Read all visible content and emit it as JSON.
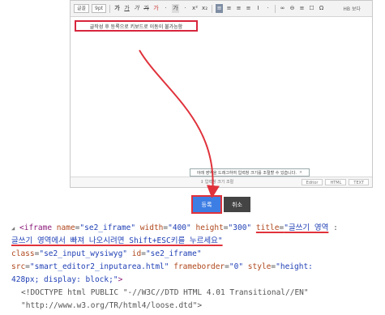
{
  "toolbar": {
    "font_select": "글꼴",
    "size_select": "9pt",
    "buttons": [
      "가",
      "가",
      "가",
      "가",
      "가",
      "·",
      "가",
      "·",
      "x²",
      "x₂",
      "≡",
      "≡",
      "≡",
      "≡",
      "I",
      "·",
      "∞",
      "⊖",
      "≡",
      "☐",
      "Ω"
    ],
    "right_label": "HB 보다"
  },
  "editor": {
    "tip_text": "글작성 후 등록으로 키보드로 이동이 불가능함",
    "status_tip": "아래 영역을 드래그하여 입력창 크기를 조절할 수 있습니다.",
    "status_tip_close": "×",
    "resize_label": "↕ 입력창 크기 조절",
    "modes": [
      "Editor",
      "HTML",
      "TEXT"
    ]
  },
  "buttons": {
    "confirm": "등록",
    "cancel": "취소"
  },
  "code": {
    "line1_triangle": "◢",
    "line1_tag_open": "<iframe",
    "line1_a1": "name",
    "line1_v1": "\"se2_iframe\"",
    "line1_a2": "width",
    "line1_v2": "\"400\"",
    "line1_a3": "height",
    "line1_v3": "\"300\"",
    "line1_a4": "title",
    "line1_v4": "\"글쓰기 영역",
    "line1_v4_tail": ":",
    "line2_v4_cont": "글쓰기 영역에서 빠져 나오시려면 Shift+ESC키를 누르세요\"",
    "line3_a5": "class",
    "line3_v5": "\"se2_input_wysiwyg\"",
    "line3_a6": "id",
    "line3_v6": "\"se2_iframe\"",
    "line4_a7": "src",
    "line4_v7": "\"smart_editor2_inputarea.html\"",
    "line4_a8": "frameborder",
    "line4_v8": "\"0\"",
    "line4_a9": "style",
    "line4_v9": "\"height:",
    "line5_v9_cont": "428px; display: block;\"",
    "line5_close": ">",
    "line6_doctype": "<!DOCTYPE html PUBLIC \"-//W3C//DTD HTML 4.01 Transitional//EN\"",
    "line7_doctype_cont": "\"http://www.w3.org/TR/html4/loose.dtd\">"
  },
  "colors": {
    "highlight_red": "#e0323b",
    "confirm_blue": "#3d7ee4",
    "tag_purple": "#8b1a7a",
    "attr_orange": "#b0471d",
    "value_blue": "#1f3fb5"
  }
}
